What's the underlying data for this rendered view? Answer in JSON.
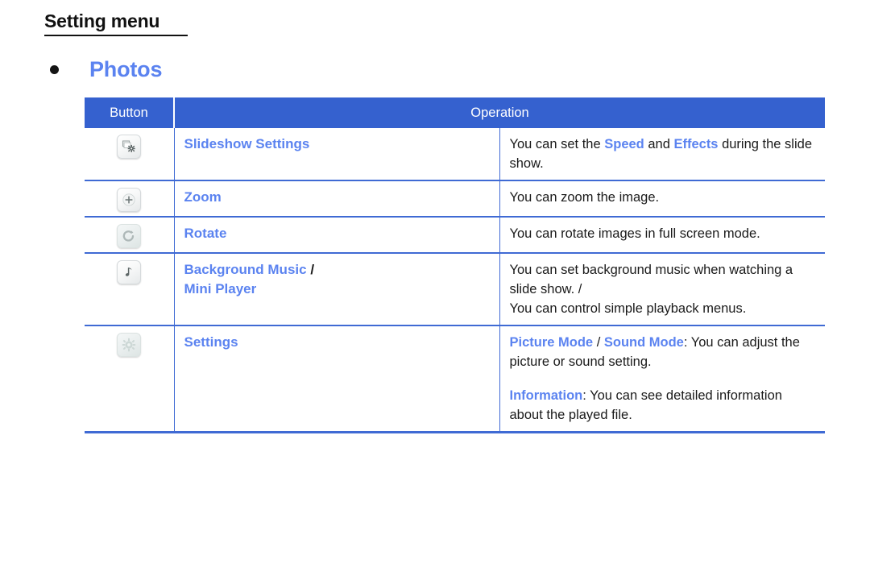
{
  "header": {
    "title": "Setting menu",
    "section_bullet_label": "Photos"
  },
  "colors": {
    "header_blue": "#3561cf",
    "accent_blue": "#5b83f0",
    "border_blue": "#3f6ad4",
    "text_black": "#1a1a1a"
  },
  "table": {
    "columns": {
      "button": "Button",
      "operation": "Operation"
    },
    "rows": [
      {
        "icon": "slideshow-settings-icon",
        "label": "Slideshow Settings",
        "label_suffix": "",
        "label_line2": "",
        "description_parts": [
          [
            {
              "t": "You can set the ",
              "k": false
            },
            {
              "t": "Speed",
              "k": true
            },
            {
              "t": " and ",
              "k": false
            },
            {
              "t": "Effects",
              "k": true
            },
            {
              "t": " during the slide show.",
              "k": false
            }
          ]
        ]
      },
      {
        "icon": "zoom-plus-icon",
        "label": "Zoom",
        "label_suffix": "",
        "label_line2": "",
        "description_parts": [
          [
            {
              "t": "You can zoom the image.",
              "k": false
            }
          ]
        ]
      },
      {
        "icon": "rotate-icon",
        "label": "Rotate",
        "label_suffix": "",
        "label_line2": "",
        "description_parts": [
          [
            {
              "t": "You can rotate images in full screen mode.",
              "k": false
            }
          ]
        ]
      },
      {
        "icon": "music-note-icon",
        "label": "Background Music",
        "label_suffix": " /",
        "label_line2": "Mini Player",
        "description_parts": [
          [
            {
              "t": "You can set background music when watching a slide show. /",
              "k": false
            },
            {
              "t": "BR",
              "k": false
            },
            {
              "t": "You can control simple playback menus.",
              "k": false
            }
          ]
        ]
      },
      {
        "icon": "settings-gear-icon",
        "label": "Settings",
        "label_suffix": "",
        "label_line2": "",
        "description_parts": [
          [
            {
              "t": "Picture Mode",
              "k": true
            },
            {
              "t": " / ",
              "k": false
            },
            {
              "t": "Sound Mode",
              "k": true
            },
            {
              "t": ": You can adjust the picture or sound setting.",
              "k": false
            }
          ],
          [
            {
              "t": "Information",
              "k": true
            },
            {
              "t": ": You can see detailed information about the played file.",
              "k": false
            }
          ]
        ]
      }
    ]
  }
}
